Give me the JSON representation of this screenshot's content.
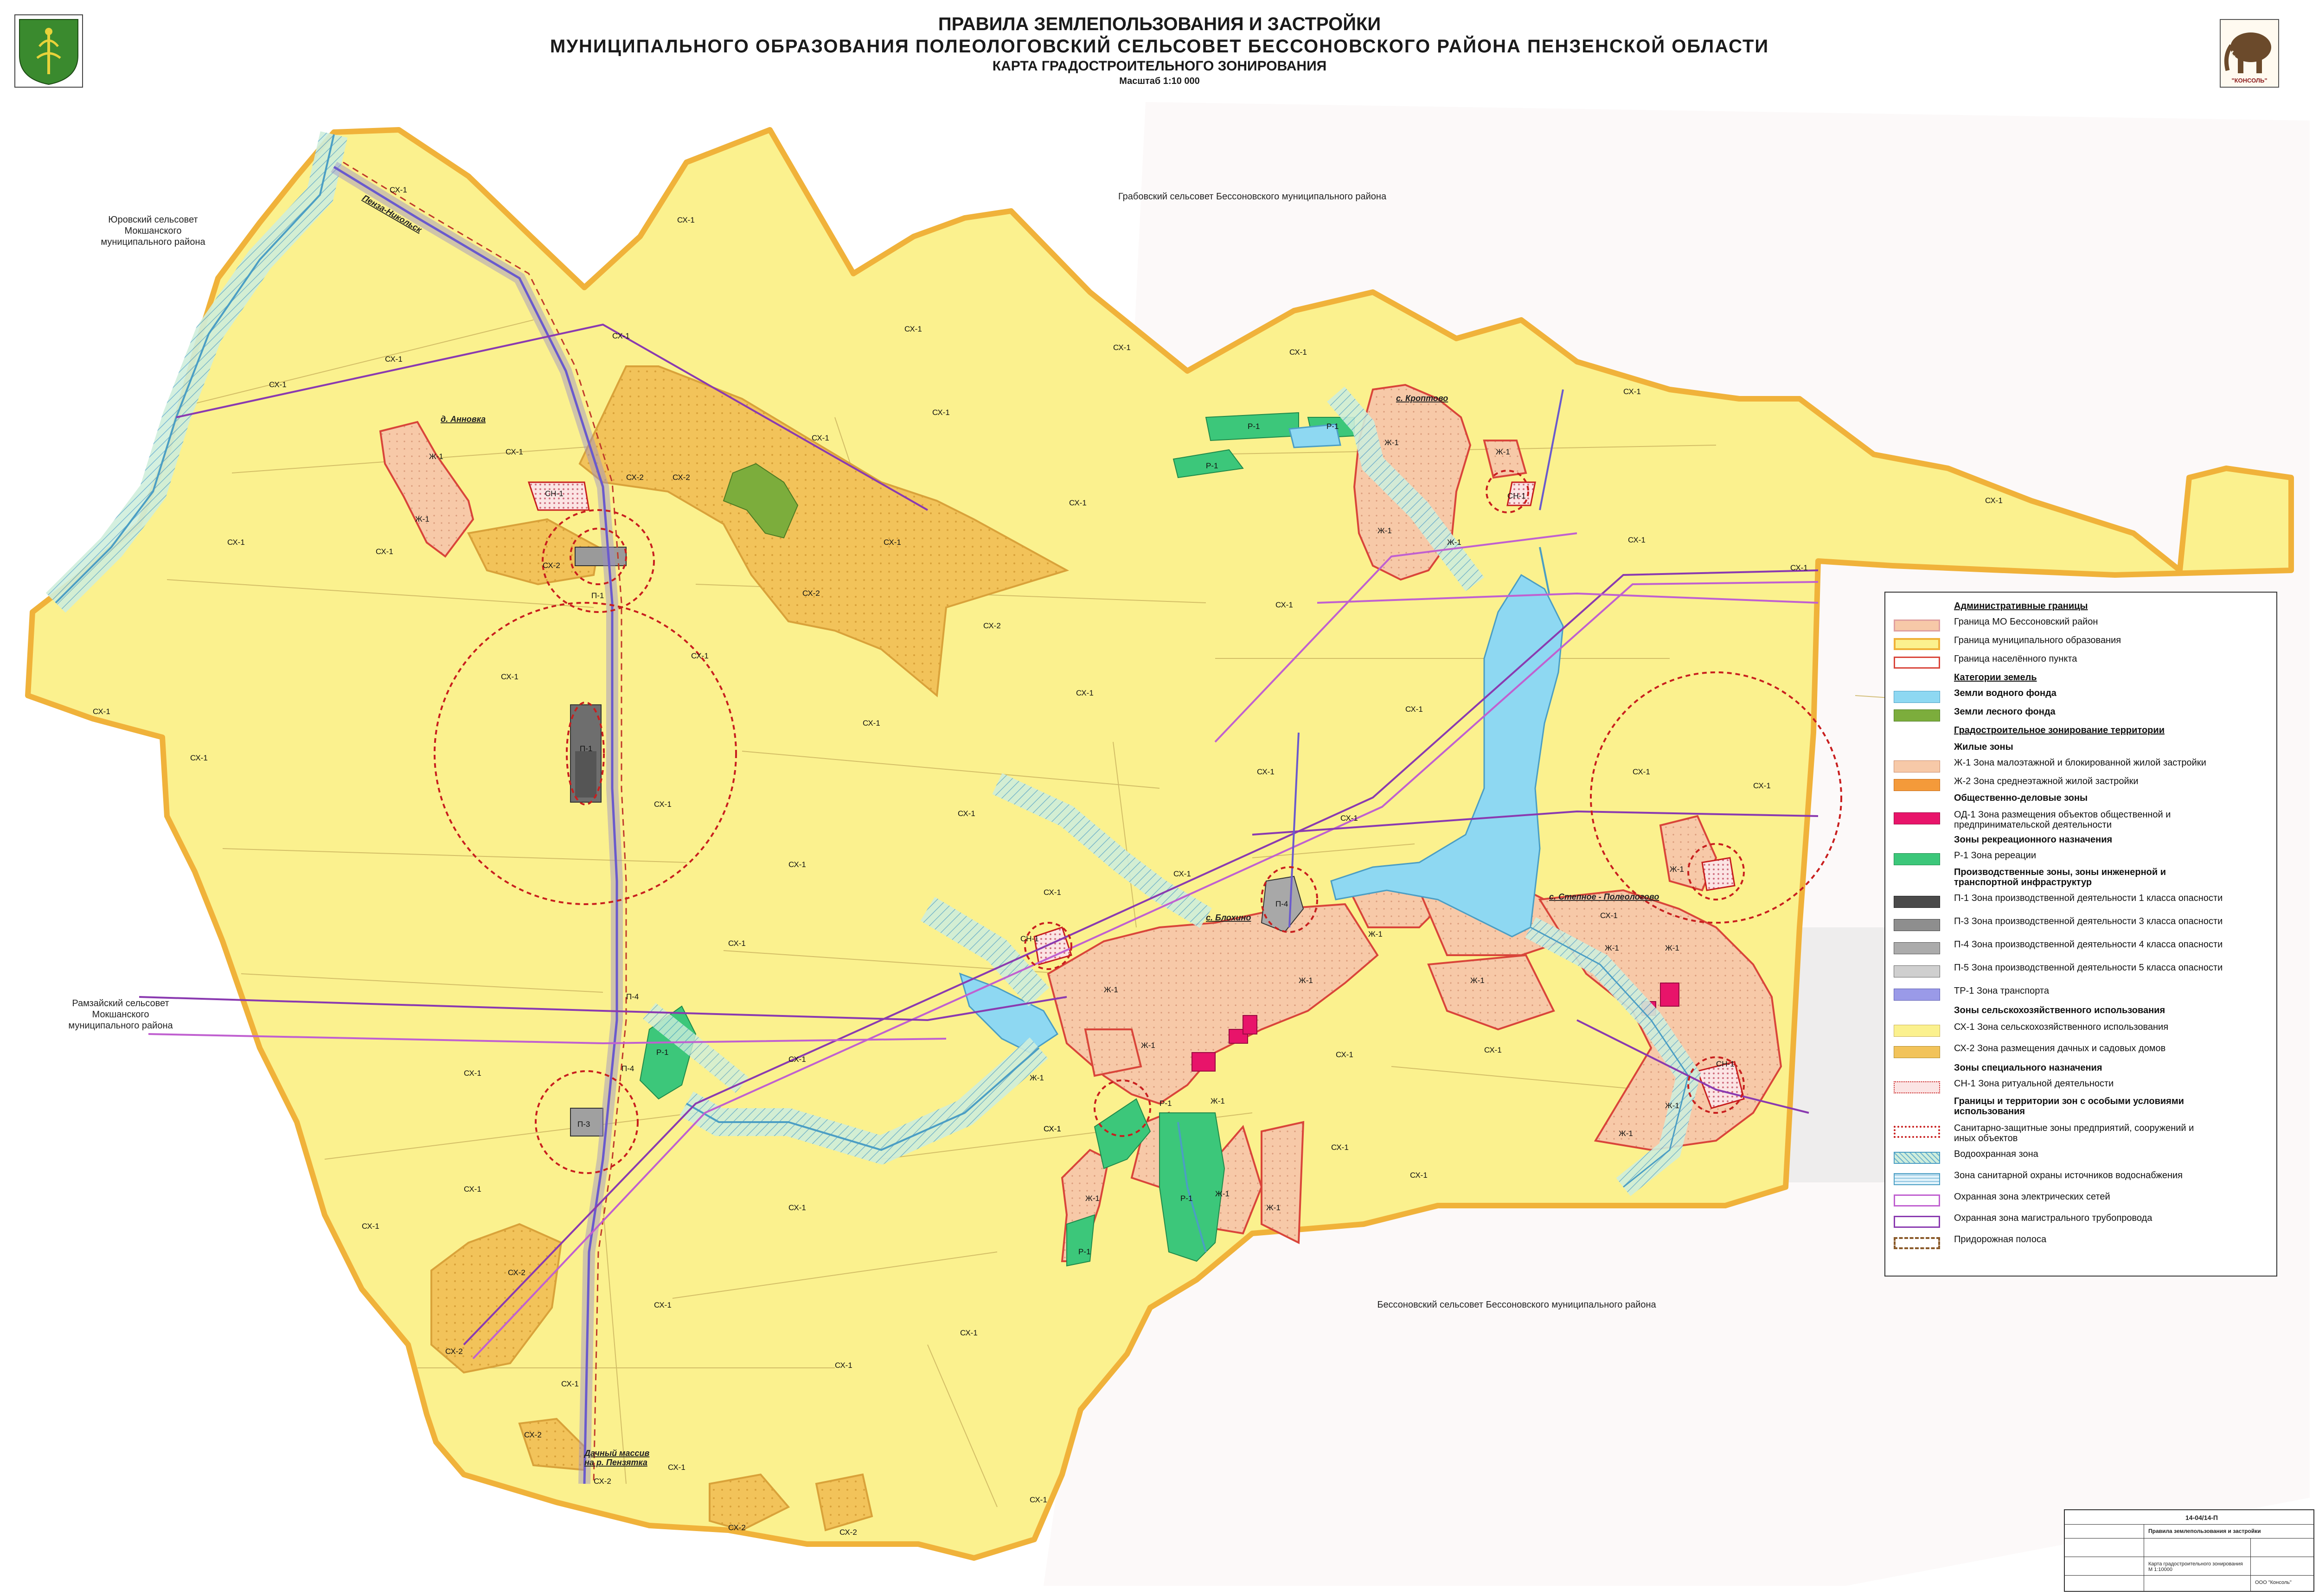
{
  "header": {
    "title_line1": "ПРАВИЛА ЗЕМЛЕПОЛЬЗОВАНИЯ И ЗАСТРОЙКИ",
    "title_line2": "МУНИЦИПАЛЬНОГО  ОБРАЗОВАНИЯ  ПОЛЕОЛОГОВСКИЙ СЕЛЬСОВЕТ  БЕССОНОВСКОГО  РАЙОНА  ПЕНЗЕНСКОЙ  ОБЛАСТИ",
    "subtitle": "КАРТА ГРАДОСТРОИТЕЛЬНОГО ЗОНИРОВАНИЯ",
    "scale": "Масштаб 1:10 000",
    "logo_text": "\"КОНСОЛЬ\""
  },
  "neighbors": {
    "yurovsky": [
      "Юровский сельсовет",
      "Мокшанского",
      "муниципального района"
    ],
    "grabovsky": "Грабовский сельсовет Бессоновского муниципального района",
    "ramzaysky": [
      "Рамзайский сельсовет",
      "Мокшанского",
      "муниципального района"
    ],
    "bessonovsky": "Бессоновский сельсовет Бессоновского муниципального района"
  },
  "settlements": {
    "annovka": "д. Анновка",
    "kroptovo": "с. Кроптово",
    "blokhino": "с. Блохино",
    "stepnoe": "с. Степное - Полеологово",
    "dacha": [
      "Дачный массив",
      "на р. Пензятка"
    ],
    "road": "Пенза-Никольск"
  },
  "zones": {
    "cx1": "СХ-1",
    "cx2": "СХ-2",
    "zh1": "Ж-1",
    "r1": "Р-1",
    "p1": "П-1",
    "p3": "П-3",
    "p4": "П-4",
    "cn1": "СН-1"
  },
  "legend": {
    "admin_title": "Административные границы",
    "admin_items": [
      "Граница МО Бессоновский район",
      "Граница муниципального образования",
      "Граница населённого пункта"
    ],
    "land_title": "Категории земель",
    "land_items": [
      "Земли водного фонда",
      "Земли лесного фонда"
    ],
    "zoning_title": "Градостроительное зонирование территории",
    "residential_title": "Жилые зоны",
    "residential_items": [
      "Ж-1 Зона малоэтажной и блокированной жилой застройки",
      "Ж-2 Зона среднеэтажной жилой застройки"
    ],
    "public_title": "Общественно-деловые зоны",
    "public_items": [
      "ОД-1 Зона размещения объектов общественной и предпринимательской деятельности"
    ],
    "recreation_title": "Зоны рекреационного назначения",
    "recreation_items": [
      "Р-1 Зона ререации"
    ],
    "industrial_title": "Производственные зоны, зоны инженерной и транспортной инфраструктур",
    "industrial_items": [
      "П-1 Зона производственной деятельности 1 класса опасности",
      "П-3 Зона производственной деятельности 3 класса опасности",
      "П-4 Зона производственной деятельности 4 класса опасности",
      "П-5 Зона производственной деятельности 5 класса опасности",
      "ТР-1 Зона транспорта"
    ],
    "agri_title": "Зоны сельскохозяйственного использования",
    "agri_items": [
      "СХ-1 Зона сельскохозяйственного использования",
      "СХ-2 Зона размещения дачных и садовых домов"
    ],
    "special_title": "Зоны специального назначения",
    "special_items": [
      "СН-1 Зона ритуальной деятельности"
    ],
    "restrict_title": "Границы и территории зон с особыми условиями использования",
    "restrict_items": [
      "Санитарно-защитные зоны предприятий, сооружений и иных объектов",
      "Водоохранная зона",
      "Зона санитарной охраны источников водоснабжения",
      "Охранная зона электрических сетей",
      "Охранная зона магистрального трубопровода",
      "Придорожная полоса"
    ]
  },
  "stamp": {
    "code": "14-04/14-П",
    "project": "Правила землепользования и застройки",
    "sheet_title": "Карта градостроительного зонирования М 1:10000",
    "org": "ООО \"Консоль\""
  },
  "colors": {
    "agri": "#fbf18e",
    "dacha": "#f2c35a",
    "residential": "#f7c9a8",
    "water": "#8ed8f2",
    "forest": "#7cad3c",
    "recreation": "#3cc77a",
    "industry": "#8e8e8e",
    "mo_border": "#f0b23a",
    "settlement_border": "#d9453a",
    "sanitary": "#c81e1e"
  }
}
